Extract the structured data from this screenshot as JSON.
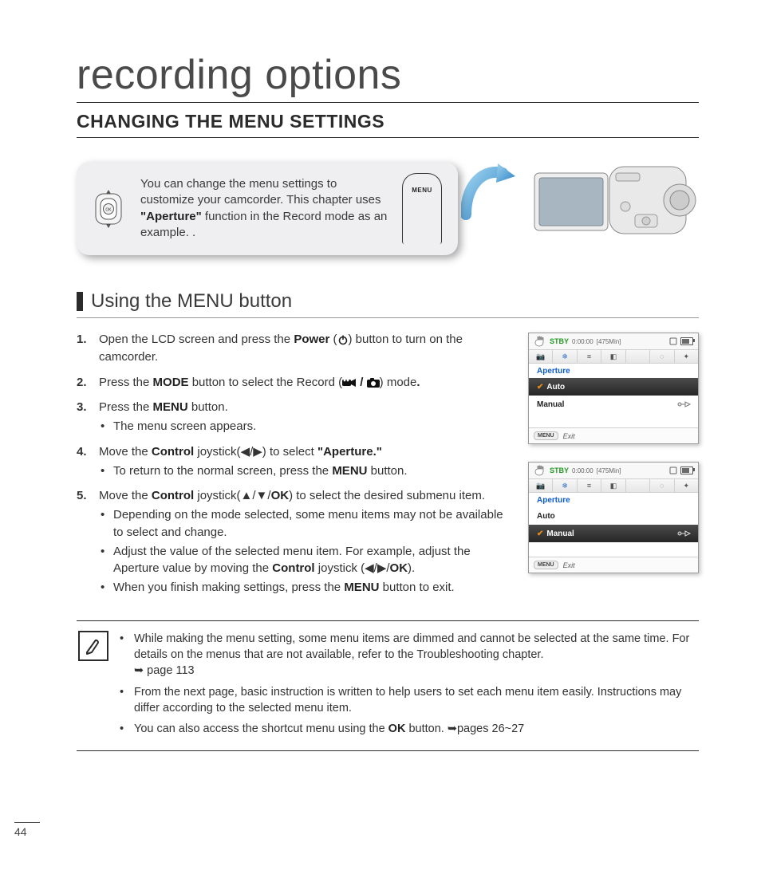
{
  "page_number": "44",
  "title": "recording options",
  "section_heading": "CHANGING THE MENU SETTINGS",
  "callout": {
    "text_pre": "You can change the menu settings to customize your camcorder. This chapter uses ",
    "text_bold": "\"Aperture\"",
    "text_post": " function in the Record mode as an example. .",
    "menu_label": "MENU"
  },
  "subsection_heading": "Using the MENU button",
  "steps": {
    "s1_a": "Open the LCD screen and press the ",
    "s1_b": "Power",
    "s1_c": " (",
    "s1_d": ") button to turn on the camcorder.",
    "s2_a": "Press the ",
    "s2_b": "MODE",
    "s2_c": " button to select the Record (",
    "s2_d": " / ",
    "s2_e": ") mode",
    "s2_f": ".",
    "s3_a": "Press the ",
    "s3_b": "MENU",
    "s3_c": " button.",
    "s3_bul1": "The menu screen appears.",
    "s4_a": "Move the ",
    "s4_b": "Control",
    "s4_c": " joystick(◀/▶) to select ",
    "s4_d": "\"Aperture.\"",
    "s4_bul1_a": "To return to the normal screen, press the ",
    "s4_bul1_b": "MENU",
    "s4_bul1_c": " button.",
    "s5_a": "Move the ",
    "s5_b": "Control",
    "s5_c": " joystick(▲/▼/",
    "s5_d": "OK",
    "s5_e": ") to select the desired submenu item.",
    "s5_bul1": "Depending on the mode selected, some menu items may not be available to select and change.",
    "s5_bul2_a": "Adjust the value of the selected menu item. For example, adjust the Aperture value by moving the ",
    "s5_bul2_b": "Control",
    "s5_bul2_c": " joystick (◀/▶/",
    "s5_bul2_d": "OK",
    "s5_bul2_e": ").",
    "s5_bul3_a": "When you finish making settings, press the ",
    "s5_bul3_b": "MENU",
    "s5_bul3_c": " button to exit."
  },
  "notes": {
    "n1_a": "While making the menu setting, some menu items are dimmed and cannot be selected at the same time. For details on the menus that are not available, refer to the Troubleshooting chapter. ",
    "n1_b": "➥ page 113",
    "n2": "From the next page, basic instruction is written to help users to set each menu item easily. Instructions may differ according to the selected menu item.",
    "n3_a": "You can also access the shortcut menu using the ",
    "n3_b": "OK",
    "n3_c": " button. ➥pages 26~27"
  },
  "screen_common": {
    "stby": "STBY",
    "time": "0:00:00",
    "remain": "[475Min]",
    "menu_title": "Aperture",
    "footer_menu": "MENU",
    "footer_exit": "Exit"
  },
  "screen1": {
    "row1_label": "Auto",
    "row1_selected": true,
    "row2_label": "Manual",
    "row2_selected": false
  },
  "screen2": {
    "row1_label": "Auto",
    "row1_selected": false,
    "row2_label": "Manual",
    "row2_selected": true
  }
}
